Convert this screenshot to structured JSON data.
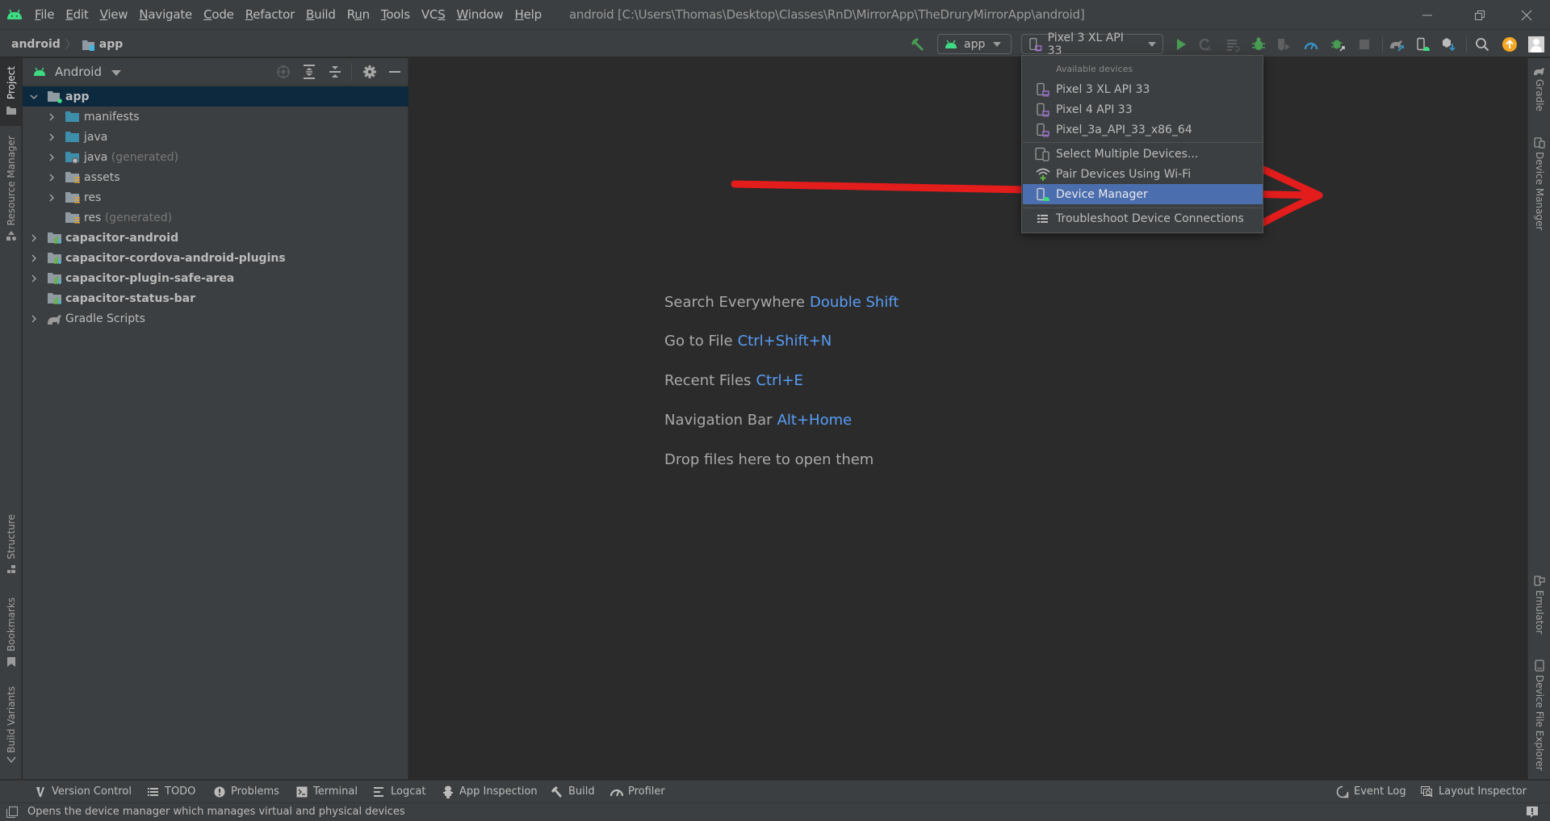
{
  "menubar": {
    "items": [
      "File",
      "Edit",
      "View",
      "Navigate",
      "Code",
      "Refactor",
      "Build",
      "Run",
      "Tools",
      "VCS",
      "Window",
      "Help"
    ],
    "mnemonics": [
      "F",
      "E",
      "V",
      "N",
      "C",
      "R",
      "B",
      "u",
      "T",
      "S",
      "W",
      "H"
    ],
    "window_title": "android [C:\\Users\\Thomas\\Desktop\\Classes\\RnD\\MirrorApp\\TheDruryMirrorApp\\android]"
  },
  "navbar": {
    "breadcrumb": [
      "android",
      "app"
    ],
    "run_config": "app",
    "device_selector": "Pixel 3 XL API 33",
    "icons": [
      "make-project-icon",
      "run-icon",
      "apply-changes-icon",
      "apply-code-changes-icon",
      "debug-icon",
      "run-with-coverage-icon",
      "profile-icon",
      "attach-debugger-icon",
      "stop-icon",
      "sync-gradle-icon",
      "device-manager-icon",
      "sdk-manager-icon",
      "search-icon",
      "update-icon",
      "account-icon"
    ]
  },
  "left_strip": {
    "tabs": [
      "Project",
      "Resource Manager",
      "Structure",
      "Bookmarks",
      "Build Variants"
    ]
  },
  "right_strip": {
    "tabs": [
      "Gradle",
      "Device Manager",
      "Emulator",
      "Device File Explorer"
    ]
  },
  "project_panel": {
    "view_mode": "Android",
    "tree": [
      {
        "label": "app",
        "suffix": "",
        "bold": true,
        "depth": 0,
        "expanded": true,
        "icon": "module-folder-icon",
        "selected": true
      },
      {
        "label": "manifests",
        "suffix": "",
        "bold": false,
        "depth": 1,
        "expanded": false,
        "icon": "source-folder-icon"
      },
      {
        "label": "java",
        "suffix": "",
        "bold": false,
        "depth": 1,
        "expanded": false,
        "icon": "source-folder-icon"
      },
      {
        "label": "java",
        "suffix": "(generated)",
        "bold": false,
        "depth": 1,
        "expanded": false,
        "icon": "generated-folder-icon"
      },
      {
        "label": "assets",
        "suffix": "",
        "bold": false,
        "depth": 1,
        "expanded": false,
        "icon": "resource-folder-icon"
      },
      {
        "label": "res",
        "suffix": "",
        "bold": false,
        "depth": 1,
        "expanded": false,
        "icon": "resource-folder-icon"
      },
      {
        "label": "res",
        "suffix": "(generated)",
        "bold": false,
        "depth": 1,
        "expanded": null,
        "icon": "resource-folder-icon"
      },
      {
        "label": "capacitor-android",
        "suffix": "",
        "bold": true,
        "depth": 0,
        "expanded": false,
        "icon": "library-module-icon"
      },
      {
        "label": "capacitor-cordova-android-plugins",
        "suffix": "",
        "bold": true,
        "depth": 0,
        "expanded": false,
        "icon": "library-module-icon"
      },
      {
        "label": "capacitor-plugin-safe-area",
        "suffix": "",
        "bold": true,
        "depth": 0,
        "expanded": false,
        "icon": "library-module-icon"
      },
      {
        "label": "capacitor-status-bar",
        "suffix": "",
        "bold": true,
        "depth": 0,
        "expanded": null,
        "icon": "library-module-icon"
      },
      {
        "label": "Gradle Scripts",
        "suffix": "",
        "bold": false,
        "depth": 0,
        "expanded": false,
        "icon": "gradle-elephant-icon"
      }
    ]
  },
  "editor": {
    "hints": [
      {
        "text": "Search Everywhere",
        "shortcut": "Double Shift"
      },
      {
        "text": "Go to File",
        "shortcut": "Ctrl+Shift+N"
      },
      {
        "text": "Recent Files",
        "shortcut": "Ctrl+E"
      },
      {
        "text": "Navigation Bar",
        "shortcut": "Alt+Home"
      },
      {
        "text": "Drop files here to open them",
        "shortcut": ""
      }
    ]
  },
  "device_popup": {
    "section_title": "Available devices",
    "devices": [
      "Pixel 3 XL API 33",
      "Pixel 4 API 33",
      "Pixel_3a_API_33_x86_64"
    ],
    "actions": [
      "Select Multiple Devices...",
      "Pair Devices Using Wi-Fi",
      "Device Manager"
    ],
    "footer_action": "Troubleshoot Device Connections",
    "highlighted": "Device Manager"
  },
  "annotation": {
    "type": "red-arrow",
    "color": "#e31c1c",
    "points_to": "Device Manager"
  },
  "bottom_tools": {
    "left": [
      "Version Control",
      "TODO",
      "Problems",
      "Terminal",
      "Logcat",
      "App Inspection",
      "Build",
      "Profiler"
    ],
    "right": [
      "Event Log",
      "Layout Inspector"
    ]
  },
  "statusbar": {
    "message": "Opens the device manager which manages virtual and physical devices"
  },
  "colors": {
    "android_green": "#3ddc84",
    "accent_blue": "#589df6",
    "selection_blue": "#4b6eaf",
    "tree_selection": "#0d293e",
    "run_green": "#499c54",
    "update_orange": "#f5a623"
  }
}
